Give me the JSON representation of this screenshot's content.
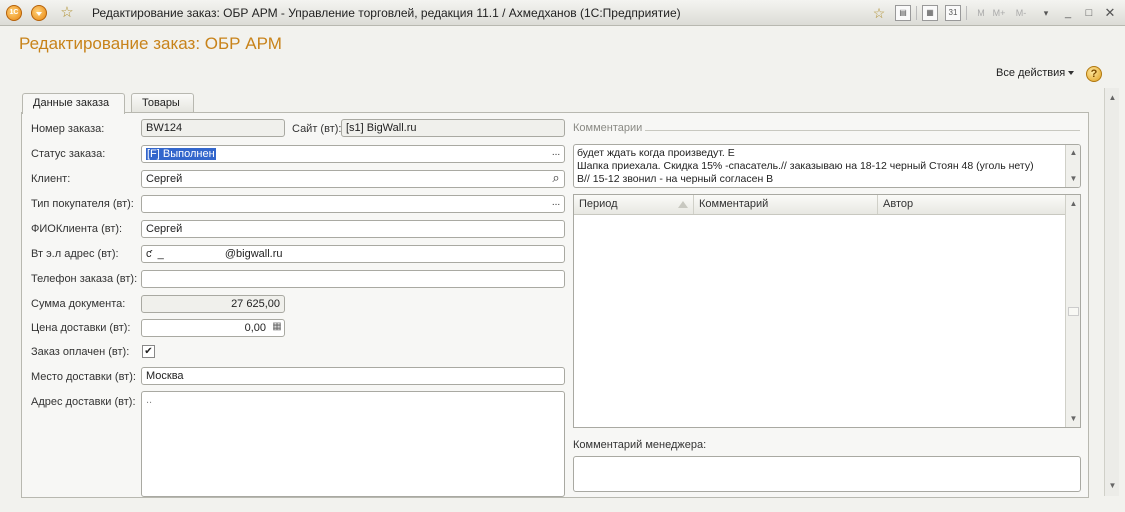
{
  "window": {
    "title": "Редактирование заказ: ОБР АРМ - Управление торговлей, редакция 11.1 / Ахмедханов  (1С:Предприятие)",
    "logo_text": "1C",
    "titlebar_right_buttons": [
      "M",
      "M+",
      "M-"
    ]
  },
  "form": {
    "title": "Редактирование заказ: ОБР АРМ",
    "all_actions_label": "Все действия",
    "help_label": "?"
  },
  "tabs": [
    {
      "label": "Данные заказа",
      "active": true
    },
    {
      "label": "Товары",
      "active": false
    }
  ],
  "fields": {
    "order_number": {
      "label": "Номер заказа:",
      "value": "BW124"
    },
    "site": {
      "label": "Сайт (вт):",
      "value": "[s1] BigWall.ru"
    },
    "status": {
      "label": "Статус заказа:",
      "value": "[F] Выполнен"
    },
    "client": {
      "label": "Клиент:",
      "value": "Сергей"
    },
    "buyer_type": {
      "label": "Тип покупателя (вт):",
      "value": ""
    },
    "client_name": {
      "label": "ФИОКлиента (вт):",
      "value": "Сергей"
    },
    "email": {
      "label": "Вт э.л адрес (вт):",
      "value": "ƈ  _                    @bigwall.ru"
    },
    "phone": {
      "label": "Телефон заказа (вт):",
      "value": ""
    },
    "doc_sum": {
      "label": "Сумма документа:",
      "value": "27 625,00"
    },
    "delivery_price": {
      "label": "Цена доставки (вт):",
      "value": "0,00"
    },
    "paid": {
      "label": "Заказ оплачен (вт):",
      "checked": true,
      "mark": "✔"
    },
    "delivery_place": {
      "label": "Место доставки (вт):",
      "value": "Москва"
    },
    "delivery_address": {
      "label": "Адрес доставки (вт):",
      "value": ".."
    }
  },
  "comments": {
    "section_title": "Комментарии",
    "lines": [
      "будет ждать когда произведут. Е",
      "Шапка  приехала. Скидка 15% -спасатель.// заказываю на 18-12 черный Стоян 48 (уголь нету)",
      "В// 15-12 звонил - на черный согласен В"
    ],
    "table_columns": [
      "Период",
      "Комментарий",
      "Автор"
    ],
    "table_rows": [],
    "manager_label": "Комментарий менеджера:",
    "manager_value": ""
  },
  "icons": {
    "ellipsis": "...",
    "search": "⌕",
    "calculator": "▦",
    "scroll_up": "▲",
    "scroll_down": "▼"
  },
  "colors": {
    "title_accent": "#c8831a",
    "selection": "#3366cc"
  }
}
